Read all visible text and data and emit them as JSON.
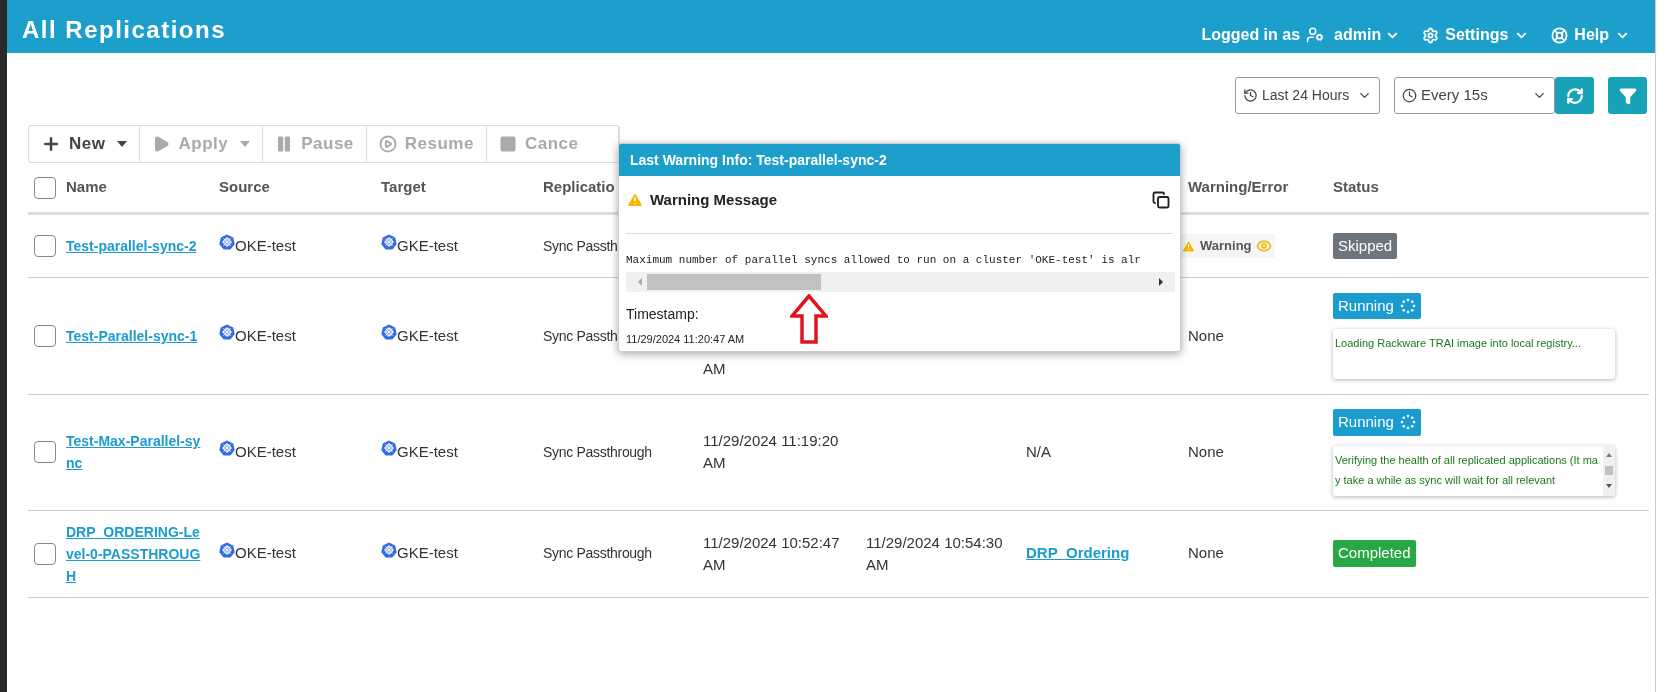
{
  "header": {
    "title": "All Replications",
    "user_prefix": "Logged in as",
    "user": "admin",
    "settings": "Settings",
    "help": "Help"
  },
  "filters": {
    "range": "Last 24 Hours",
    "refresh": "Every 15s"
  },
  "toolbar": [
    {
      "label": "New",
      "kind": "new",
      "caret": true,
      "disabled": false
    },
    {
      "label": "Apply",
      "kind": "apply",
      "caret": true,
      "disabled": true
    },
    {
      "label": "Pause",
      "kind": "pause",
      "caret": false,
      "disabled": true
    },
    {
      "label": "Resume",
      "kind": "resume",
      "caret": false,
      "disabled": true
    },
    {
      "label": "Cance",
      "kind": "cancel",
      "caret": false,
      "disabled": true
    }
  ],
  "table": {
    "select_all": {
      "checked": false
    },
    "columns": [
      "Name",
      "Source",
      "Target",
      "Replicatio",
      "Warning/Error",
      "Status"
    ],
    "rows": [
      {
        "checked": false,
        "name": "Test-parallel-sync-2",
        "source": "OKE-test",
        "target": "GKE-test",
        "type": "Sync Passth",
        "warning": {
          "kind": "badge",
          "text": "Warning"
        },
        "status": {
          "kind": "skipped",
          "label": "Skipped"
        }
      },
      {
        "checked": false,
        "name": "Test-Parallel-sync-1",
        "source": "OKE-test",
        "target": "GKE-test",
        "type": "Sync Passth",
        "start": "AM",
        "warning": {
          "kind": "text",
          "text": "None"
        },
        "status": {
          "kind": "running",
          "label": "Running"
        },
        "message": {
          "text": "Loading Rackware TRAI image into local registry...",
          "scrollbar": false
        }
      },
      {
        "checked": false,
        "name": "Test-Max-Parallel-sync",
        "source": "OKE-test",
        "target": "GKE-test",
        "type": "Sync Passthrough",
        "start": "11/29/2024 11:19:20 AM",
        "policy": {
          "kind": "text",
          "text": "N/A"
        },
        "warning": {
          "kind": "text",
          "text": "None"
        },
        "status": {
          "kind": "running",
          "label": "Running"
        },
        "message": {
          "text": "Verifying the health of all replicated applications (It may take a while as sync will wait for all relevant",
          "scrollbar": true
        }
      },
      {
        "checked": false,
        "name": "DRP_ORDERING-Level-0-PASSTHROUGH",
        "source": "OKE-test",
        "target": "GKE-test",
        "type": "Sync Passthrough",
        "start": "11/29/2024 10:52:47 AM",
        "end": "11/29/2024 10:54:30 AM",
        "policy": {
          "kind": "link",
          "text": "DRP_Ordering"
        },
        "warning": {
          "kind": "text",
          "text": "None"
        },
        "status": {
          "kind": "completed",
          "label": "Completed"
        }
      }
    ]
  },
  "popup": {
    "title": "Last Warning Info: Test-parallel-sync-2",
    "heading": "Warning Message",
    "message": "Maximum number of parallel syncs allowed to run on a cluster 'OKE-test' is alr",
    "timestamp_label": "Timestamp:",
    "timestamp": "11/29/2024 11:20:47 AM"
  }
}
